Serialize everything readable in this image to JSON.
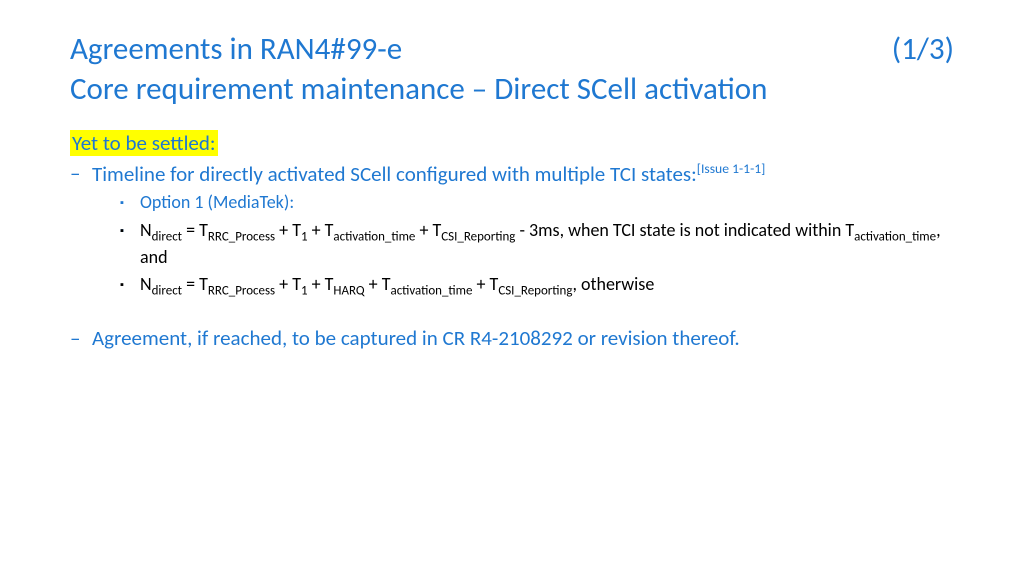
{
  "header": {
    "title_main": "Agreements in RAN4#99-e",
    "page_num": "(1/3)",
    "subtitle": "Core requirement maintenance – Direct SCell activation"
  },
  "highlight": "Yet to be settled:",
  "bullets": {
    "b1_prefix": "Timeline for directly activated SCell configured with multiple TCI states:",
    "b1_sup": "[Issue 1-1-1]",
    "b2": "Option 1 (MediaTek):",
    "formula1": {
      "n": "N",
      "n_sub": "direct",
      "eq": " = T",
      "rrc_sub": "RRC_Process",
      "plus_t1": " + T",
      "one_sub": "1",
      "plus_tact": " + T",
      "act_sub": "activation_time",
      "plus_tcsi": " + T",
      "csi_sub": "CSI_Reporting",
      "tail_a": " - 3ms, when TCI state is not indicated within T",
      "tail_a_sub": "activation_time",
      "tail_a_end": ", and"
    },
    "formula2": {
      "n": "N",
      "n_sub": "direct",
      "eq": " = T",
      "rrc_sub": "RRC_Process",
      "plus_t1": " + T",
      "one_sub": "1",
      "plus_tharq": " + T",
      "harq_sub": "HARQ",
      "plus_tact": " + T",
      "act_sub": "activation_time",
      "plus_tcsi": " + T",
      "csi_sub": "CSI_Reporting",
      "tail": ", otherwise"
    },
    "agreement": "Agreement, if reached, to be captured in CR R4-2108292 or revision thereof."
  }
}
